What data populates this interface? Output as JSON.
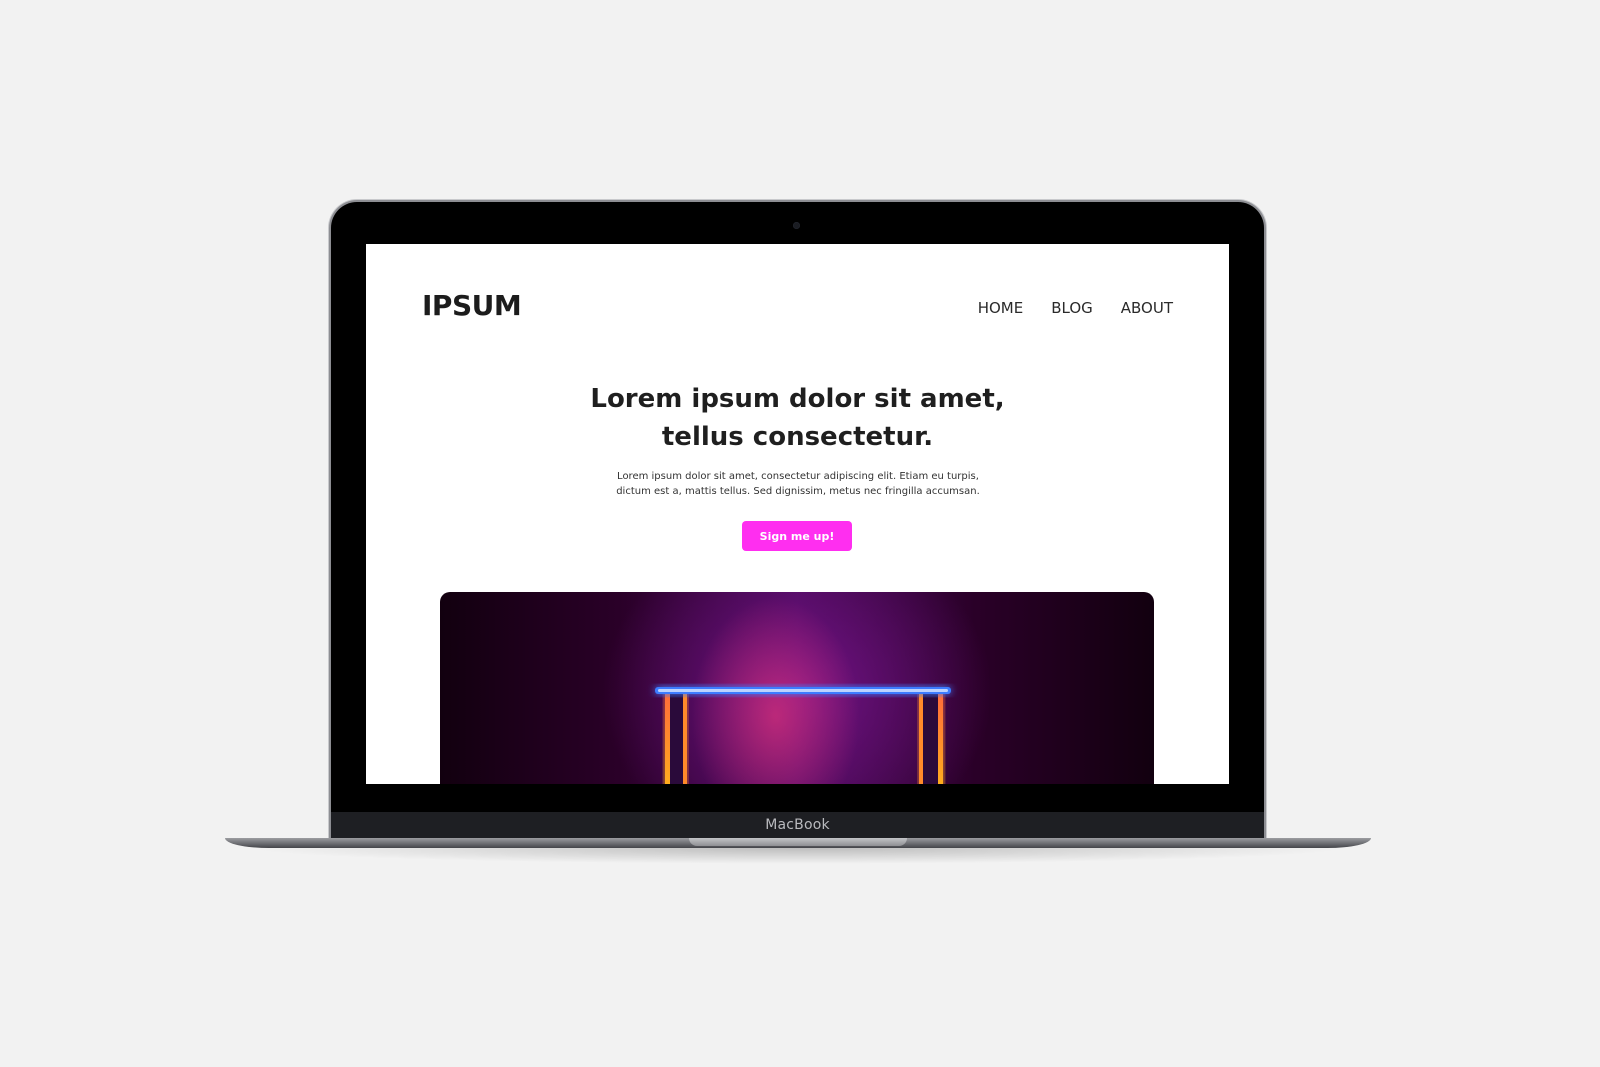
{
  "device": {
    "brand_label": "MacBook"
  },
  "site": {
    "logo": "IPSUM",
    "nav": [
      {
        "label": "HOME"
      },
      {
        "label": "BLOG"
      },
      {
        "label": "ABOUT"
      }
    ],
    "hero": {
      "title_line1": "Lorem ipsum dolor sit amet,",
      "title_line2": "tellus consectetur.",
      "text_line1": "Lorem ipsum dolor sit amet, consectetur adipiscing elit. Etiam eu turpis,",
      "text_line2": "dictum est a, mattis tellus. Sed dignissim, metus nec fringilla accumsan.",
      "cta_label": "Sign me up!"
    }
  },
  "colors": {
    "page_background": "#f2f2f2",
    "accent": "#ff2ef0",
    "text": "#1f1f1f"
  }
}
